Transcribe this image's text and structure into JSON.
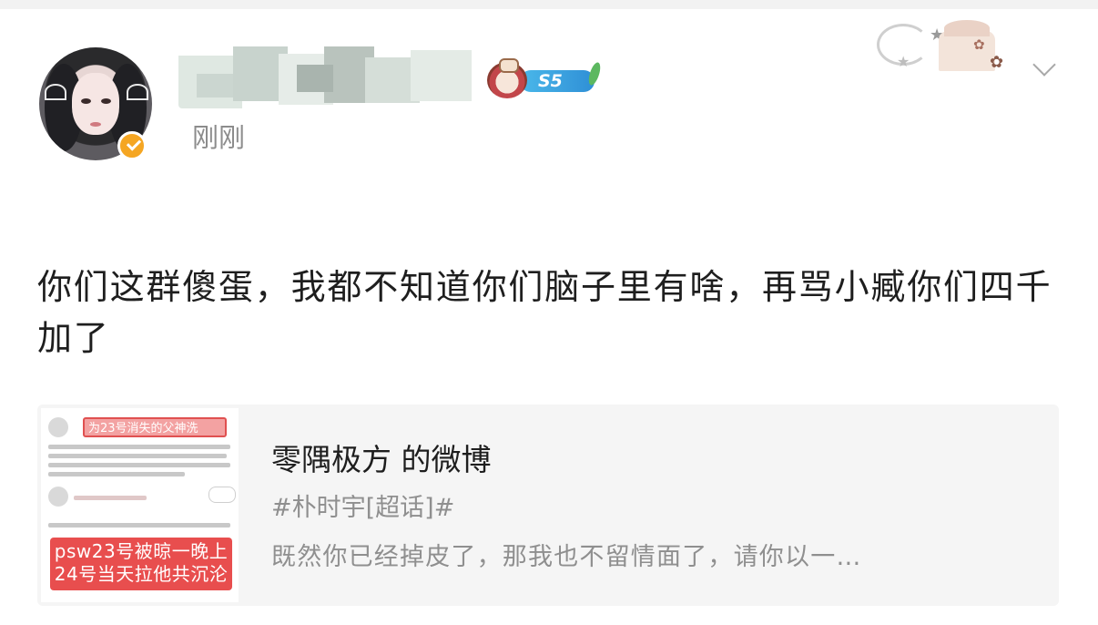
{
  "post": {
    "timestamp": "刚刚",
    "level_label": "S5",
    "text": "你们这群傻蛋，我都不知道你们脑子里有啥，再骂小臧你们四千加了"
  },
  "quote_card": {
    "title": "零隅极方 的微博",
    "tag": "#朴时宇[超话]#",
    "excerpt": "既然你已经掉皮了，那我也不留情面了，请你以一…",
    "thumbnail": {
      "title_text": "为23号消失的父神洗",
      "red_box_lines": [
        "psw23号被晾一晚上",
        "24号当天拉他共沉沦"
      ]
    }
  },
  "colors": {
    "accent_verified": "#f5a623",
    "level_badge": "#2f8fd6",
    "text_primary": "#1e1e1e",
    "text_secondary": "#8c8c8c",
    "card_background": "#f5f5f5"
  },
  "icons": [
    "verified-badge-icon",
    "chevron-down-icon",
    "level-badge-icon"
  ]
}
